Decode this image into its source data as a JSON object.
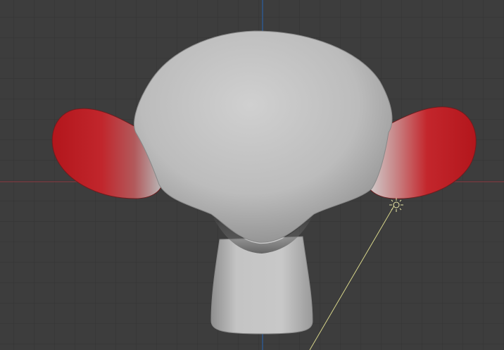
{
  "viewport": {
    "view": "front-orthographic",
    "object": "monkey-mesh",
    "grid": true,
    "colors": {
      "background": "#3d3d3d",
      "grid_minor": "#353535",
      "grid_major": "#2f2f2f",
      "axis_x": "#8a3b42",
      "axis_z": "#2a5e9e",
      "mesh": "#bdbdbd",
      "ear_paint": "#c41e24",
      "light_line": "#d6d48a"
    }
  }
}
